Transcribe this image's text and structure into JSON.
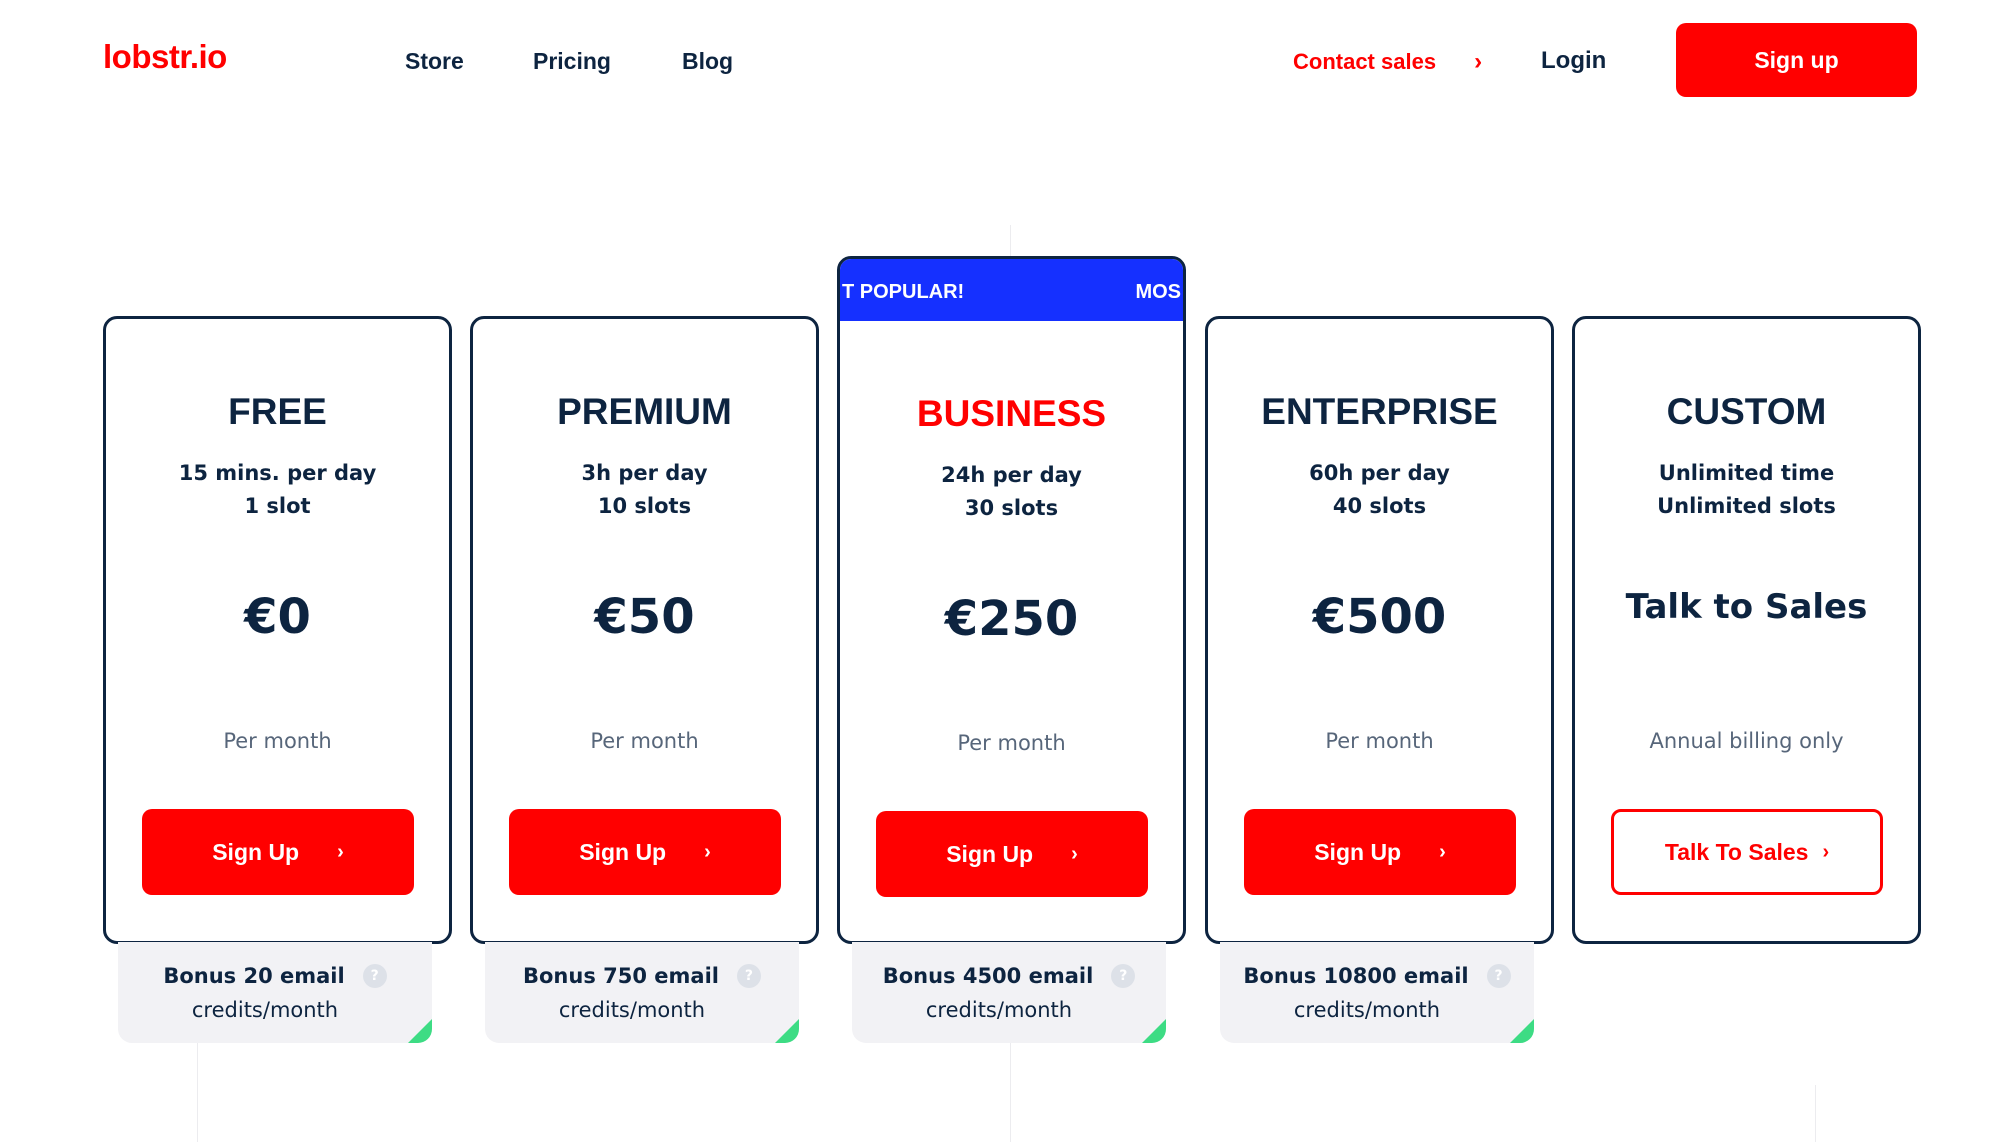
{
  "header": {
    "logo": "lobstr.io",
    "nav": [
      "Store",
      "Pricing",
      "Blog"
    ],
    "contact_sales": "Contact sales",
    "contact_chevron": "›",
    "login": "Login",
    "signup": "Sign up"
  },
  "colors": {
    "brand_red": "#ff0000",
    "navy": "#0d2440",
    "popular_blue": "#1530ff",
    "bonus_bg": "#f2f2f5",
    "corner_green": "#3ddc84"
  },
  "plans": [
    {
      "name": "FREE",
      "features": [
        "15 mins. per day",
        "1 slot"
      ],
      "price": "€0",
      "period": "Per month",
      "cta": "Sign Up",
      "bonus_line1": "Bonus 20 email",
      "bonus_line2": "credits/month"
    },
    {
      "name": "PREMIUM",
      "features": [
        "3h per day",
        "10 slots"
      ],
      "price": "€50",
      "period": "Per month",
      "cta": "Sign Up",
      "bonus_line1": "Bonus 750 email",
      "bonus_line2": "credits/month"
    },
    {
      "name": "BUSINESS",
      "badge_left": "T POPULAR!",
      "badge_right": "MOS",
      "features": [
        "24h per day",
        "30 slots"
      ],
      "price": "€250",
      "period": "Per month",
      "cta": "Sign Up",
      "bonus_line1": "Bonus 4500 email",
      "bonus_line2": "credits/month"
    },
    {
      "name": "ENTERPRISE",
      "features": [
        "60h per day",
        "40 slots"
      ],
      "price": "€500",
      "period": "Per month",
      "cta": "Sign Up",
      "bonus_line1": "Bonus 10800 email",
      "bonus_line2": "credits/month"
    },
    {
      "name": "CUSTOM",
      "features": [
        "Unlimited time",
        "Unlimited slots"
      ],
      "price": "Talk to Sales",
      "period": "Annual billing only",
      "cta": "Talk To Sales"
    }
  ],
  "icons": {
    "chevron": "›",
    "help": "?"
  }
}
